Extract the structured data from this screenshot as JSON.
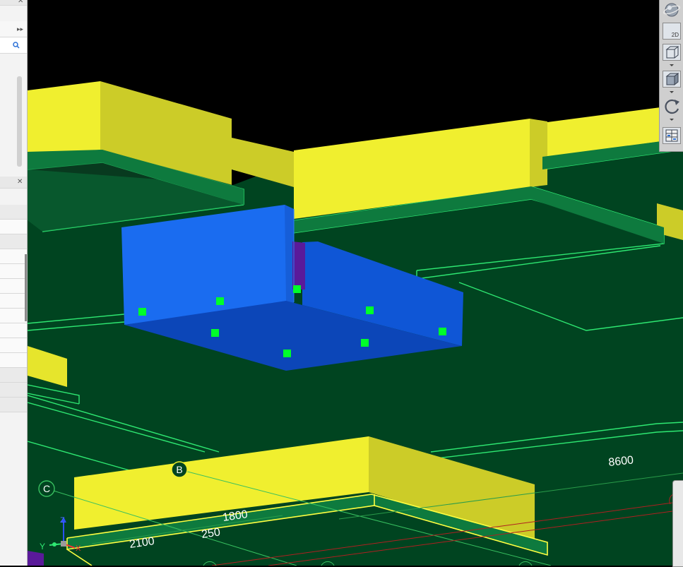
{
  "viewport": {
    "background": "#000000",
    "colors": {
      "slab": "#004420",
      "slab_edge": "#2ee872",
      "beam_top": "#f0ef2f",
      "beam_side": "#cccc28",
      "wall": "#1a6cf0",
      "wall_floor": "#0d4ec8",
      "control_point": "#00ff2a",
      "column": "#5a1a9a",
      "selection": "#ffff40"
    },
    "dimension_labels": {
      "d8600": "8600",
      "d1800": "1800",
      "d250": "250",
      "d2100": "2100"
    },
    "grid_labels": {
      "b": "B",
      "c": "C"
    },
    "axis_triad": {
      "z": "Z",
      "y": "Y",
      "x": "X"
    }
  },
  "toolbar": {
    "items": [
      {
        "name": "orbit-sphere",
        "label": ""
      },
      {
        "name": "2d-view",
        "label": "2D"
      },
      {
        "name": "wireframe-box",
        "label": ""
      },
      {
        "name": "solid-box",
        "label": ""
      },
      {
        "name": "rotate",
        "label": ""
      },
      {
        "name": "view-settings",
        "label": ""
      }
    ]
  }
}
